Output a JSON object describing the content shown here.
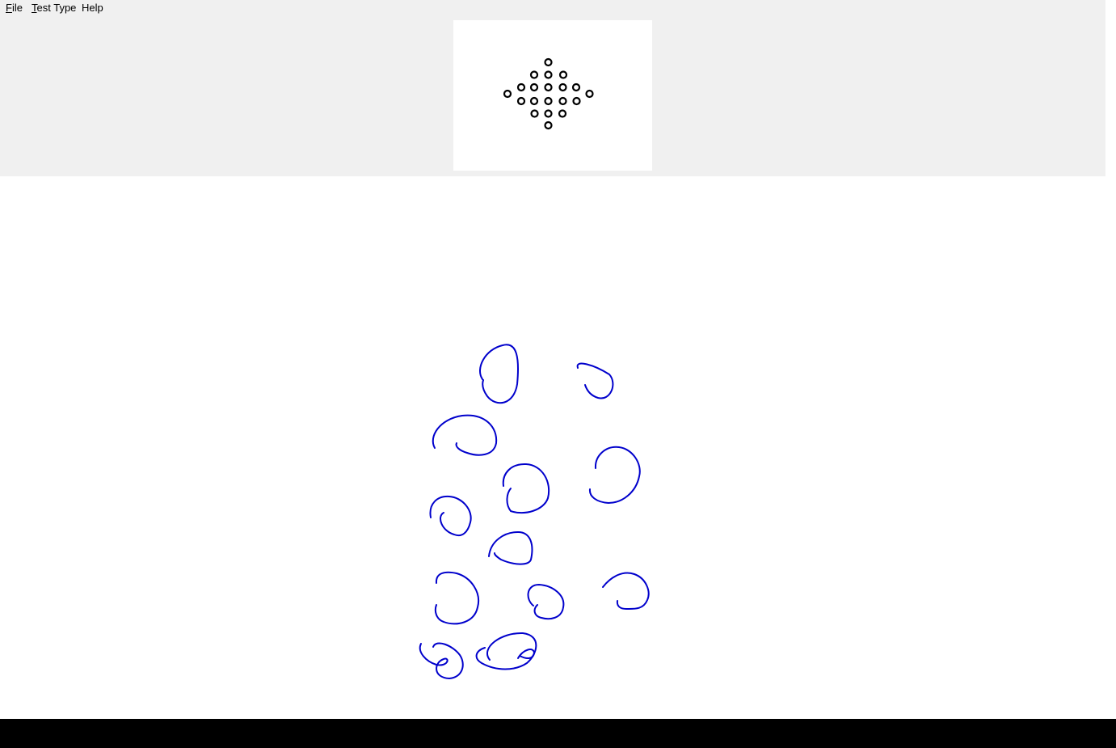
{
  "menu": {
    "file": {
      "mnemonic": "F",
      "rest": "ile"
    },
    "test_type": {
      "mnemonic": "T",
      "rest": "est Type"
    },
    "help": {
      "label": "Help"
    }
  },
  "colors": {
    "window_bg": "#f0f0f0",
    "panel_bg": "#ffffff",
    "dot_stroke": "#000000",
    "ink_stroke": "#0000cc",
    "taskbar": "#000000"
  },
  "pattern": {
    "shape": "diamond",
    "row_counts": [
      1,
      3,
      7,
      5,
      3,
      1
    ],
    "total_dots": 20
  },
  "drawing": {
    "ink_shape": "loop",
    "stroke_count": 14
  }
}
